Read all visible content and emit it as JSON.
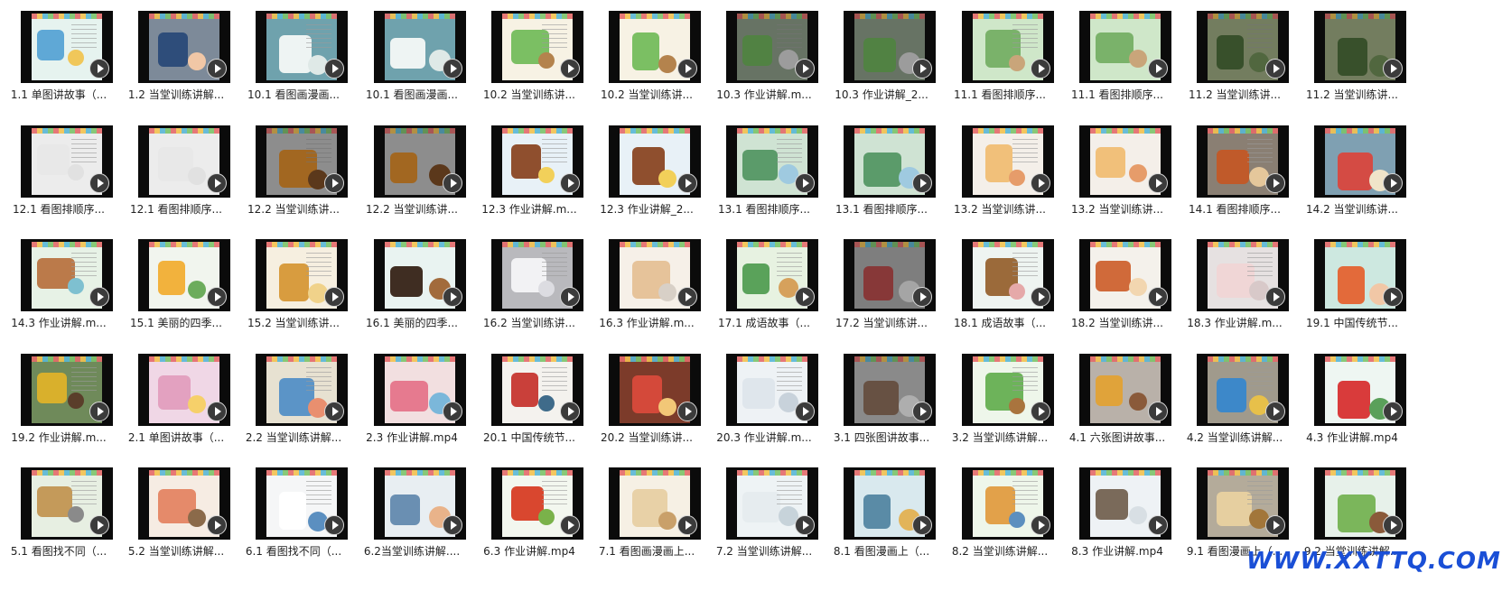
{
  "files": [
    {
      "label": "1.1 单图讲故事（...",
      "bg": "#e6f3ef",
      "f1": "#5fa8d6",
      "f2": "#f0c75a"
    },
    {
      "label": "1.2 当堂训练讲解...",
      "bg": "#7d8a99",
      "f1": "#2e4d7a",
      "f2": "#f1c7a6"
    },
    {
      "label": "10.1 看图画漫画...",
      "bg": "#6fa2ad",
      "f1": "#eef4f3",
      "f2": "#dfe9e7"
    },
    {
      "label": "10.1 看图画漫画...",
      "bg": "#6fa2ad",
      "f1": "#eef4f3",
      "f2": "#dfe9e7"
    },
    {
      "label": "10.2 当堂训练讲...",
      "bg": "#f7f2e4",
      "f1": "#7bbf63",
      "f2": "#b4834d"
    },
    {
      "label": "10.2 当堂训练讲...",
      "bg": "#f7f2e4",
      "f1": "#7bbf63",
      "f2": "#b4834d"
    },
    {
      "label": "10.3 作业讲解.m...",
      "bg": "#8a9a86",
      "f1": "#6cae5a",
      "f2": "#d0d0d0"
    },
    {
      "label": "10.3 作业讲解_2...",
      "bg": "#8a9a86",
      "f1": "#6cae5a",
      "f2": "#d0d0d0"
    },
    {
      "label": "11.1 看图排顺序...",
      "bg": "#cfe7c9",
      "f1": "#7ab26a",
      "f2": "#c9a57a"
    },
    {
      "label": "11.1 看图排顺序...",
      "bg": "#cfe7c9",
      "f1": "#7ab26a",
      "f2": "#c9a57a"
    },
    {
      "label": "11.2 当堂训练讲...",
      "bg": "#9aa77f",
      "f1": "#4b6b3a",
      "f2": "#6d8a55"
    },
    {
      "label": "11.2 当堂训练讲...",
      "bg": "#9aa77f",
      "f1": "#4b6b3a",
      "f2": "#6d8a55"
    },
    {
      "label": "12.1 看图排顺序...",
      "bg": "#ececec",
      "f1": "#e8e8e8",
      "f2": "#e1e1e1"
    },
    {
      "label": "12.1 看图排顺序...",
      "bg": "#ececec",
      "f1": "#e8e8e8",
      "f2": "#e1e1e1"
    },
    {
      "label": "12.2 当堂训练讲...",
      "bg": "#bdbdbd",
      "f1": "#d88a2c",
      "f2": "#7a4b24"
    },
    {
      "label": "12.2 当堂训练讲...",
      "bg": "#bdbdbd",
      "f1": "#d88a2c",
      "f2": "#7a4b24"
    },
    {
      "label": "12.3 作业讲解.m...",
      "bg": "#e8f1f7",
      "f1": "#8f4f2e",
      "f2": "#f2d05a"
    },
    {
      "label": "12.3 作业讲解_2...",
      "bg": "#e8f1f7",
      "f1": "#8f4f2e",
      "f2": "#f2d05a"
    },
    {
      "label": "13.1 看图排顺序...",
      "bg": "#cfe3d3",
      "f1": "#5b9b6a",
      "f2": "#9fcae0"
    },
    {
      "label": "13.1 看图排顺序...",
      "bg": "#cfe3d3",
      "f1": "#5b9b6a",
      "f2": "#9fcae0"
    },
    {
      "label": "13.2 当堂训练讲...",
      "bg": "#f4efe9",
      "f1": "#f1c07a",
      "f2": "#e69c6a"
    },
    {
      "label": "13.2 当堂训练讲...",
      "bg": "#f4efe9",
      "f1": "#f1c07a",
      "f2": "#e69c6a"
    },
    {
      "label": "14.1 看图排顺序...",
      "bg": "#8a7f73",
      "f1": "#c05a2a",
      "f2": "#e5c79b"
    },
    {
      "label": "14.2 当堂训练讲...",
      "bg": "#7fa0b2",
      "f1": "#d44b44",
      "f2": "#f0e4c9"
    },
    {
      "label": "14.3 作业讲解.m...",
      "bg": "#e7f2e6",
      "f1": "#bb7a4a",
      "f2": "#7ec0d0"
    },
    {
      "label": "15.1 美丽的四季...",
      "bg": "#f1f5ee",
      "f1": "#f2b23d",
      "f2": "#6cac5c"
    },
    {
      "label": "15.2 当堂训练讲...",
      "bg": "#f6efe0",
      "f1": "#d89c3f",
      "f2": "#f0d28a"
    },
    {
      "label": "16.1 美丽的四季...",
      "bg": "#e9f3f1",
      "f1": "#3f2d22",
      "f2": "#a26b3c"
    },
    {
      "label": "16.2 当堂训练讲...",
      "bg": "#b9b9bd",
      "f1": "#f2f2f4",
      "f2": "#dcdce1"
    },
    {
      "label": "16.3 作业讲解.m...",
      "bg": "#f6f0e8",
      "f1": "#e6c39a",
      "f2": "#d8d0c7"
    },
    {
      "label": "17.1 成语故事（...",
      "bg": "#e7f2e1",
      "f1": "#5aa25a",
      "f2": "#d6a15c"
    },
    {
      "label": "17.2 当堂训练讲...",
      "bg": "#a8a8a8",
      "f1": "#b54b4b",
      "f2": "#dddddd"
    },
    {
      "label": "18.1 成语故事（...",
      "bg": "#eef4f1",
      "f1": "#9b6a3a",
      "f2": "#e5a9a9"
    },
    {
      "label": "18.2 当堂训练讲...",
      "bg": "#f4f1eb",
      "f1": "#d06a3a",
      "f2": "#f2d6b0"
    },
    {
      "label": "18.3 作业讲解.m...",
      "bg": "#e6e1e1",
      "f1": "#f0d6d6",
      "f2": "#d8c9c9"
    },
    {
      "label": "19.1 中国传统节...",
      "bg": "#cde8e0",
      "f1": "#e36a3a",
      "f2": "#f1c7a6"
    },
    {
      "label": "19.2 作业讲解.m...",
      "bg": "#6f8a5a",
      "f1": "#d9b02c",
      "f2": "#5a3e2a"
    },
    {
      "label": "2.1 单图讲故事（...",
      "bg": "#f0d7e6",
      "f1": "#e3a1c0",
      "f2": "#f6d06a"
    },
    {
      "label": "2.2 当堂训练讲解...",
      "bg": "#e7e1d1",
      "f1": "#5b94c7",
      "f2": "#e98f6f"
    },
    {
      "label": "2.3 作业讲解.mp4",
      "bg": "#f2dfe0",
      "f1": "#e67a8f",
      "f2": "#7bb7da"
    },
    {
      "label": "20.1 中国传统节...",
      "bg": "#f4f2ee",
      "f1": "#c9403a",
      "f2": "#3f6b8a"
    },
    {
      "label": "20.2 当堂训练讲...",
      "bg": "#7c3b2a",
      "f1": "#d4493a",
      "f2": "#f2c777"
    },
    {
      "label": "20.3 作业讲解.m...",
      "bg": "#eef2f5",
      "f1": "#dfe6ec",
      "f2": "#c8d2db"
    },
    {
      "label": "3.1 四张图讲故事...",
      "bg": "#b8b8b8",
      "f1": "#8a6d5a",
      "f2": "#e8e8e8"
    },
    {
      "label": "3.2 当堂训练讲解...",
      "bg": "#eef6ea",
      "f1": "#6db35a",
      "f2": "#a9743e"
    },
    {
      "label": "4.1 六张图讲故事...",
      "bg": "#b9b1a9",
      "f1": "#e0a33a",
      "f2": "#8a5a3a"
    },
    {
      "label": "4.2 当堂训练讲解...",
      "bg": "#a09a8c",
      "f1": "#3d88c9",
      "f2": "#e7c04a"
    },
    {
      "label": "4.3 作业讲解.mp4",
      "bg": "#eef6f2",
      "f1": "#d93b3b",
      "f2": "#5aa05a"
    },
    {
      "label": "5.1 看图找不同（...",
      "bg": "#e7efe2",
      "f1": "#c49a5a",
      "f2": "#8a8a8a"
    },
    {
      "label": "5.2 当堂训练讲解...",
      "bg": "#f6ece3",
      "f1": "#e58a6a",
      "f2": "#8b6a4a"
    },
    {
      "label": "6.1 看图找不同（...",
      "bg": "#f5f6f7",
      "f1": "#ffffff",
      "f2": "#5b8fc0"
    },
    {
      "label": "6.2当堂训练讲解....",
      "bg": "#e8eef2",
      "f1": "#6a8fb2",
      "f2": "#e9b38a"
    },
    {
      "label": "6.3 作业讲解.mp4",
      "bg": "#f3f7ef",
      "f1": "#d9472f",
      "f2": "#7ab24a"
    },
    {
      "label": "7.1 看图画漫画上...",
      "bg": "#f6f0e4",
      "f1": "#e8d1a7",
      "f2": "#c9a06a"
    },
    {
      "label": "7.2 当堂训练讲解...",
      "bg": "#eef3f5",
      "f1": "#e6ecef",
      "f2": "#c7d3da"
    },
    {
      "label": "8.1 看图漫画上（...",
      "bg": "#d9e9ee",
      "f1": "#5a8ba6",
      "f2": "#e2b45a"
    },
    {
      "label": "8.2 当堂训练讲解...",
      "bg": "#eef6ea",
      "f1": "#e2a14a",
      "f2": "#5c8fbf"
    },
    {
      "label": "8.3 作业讲解.mp4",
      "bg": "#eef2f5",
      "f1": "#7a6a5a",
      "f2": "#d8dfe4"
    },
    {
      "label": "9.1 看图漫画上（...",
      "bg": "#b4ab9a",
      "f1": "#e6cfa0",
      "f2": "#a2763a"
    },
    {
      "label": "9.2 当堂训练讲解...",
      "bg": "#e7f1ea",
      "f1": "#7bb65b",
      "f2": "#8a5a3a"
    }
  ],
  "watermark": "WWW.XXTTQ.COM"
}
